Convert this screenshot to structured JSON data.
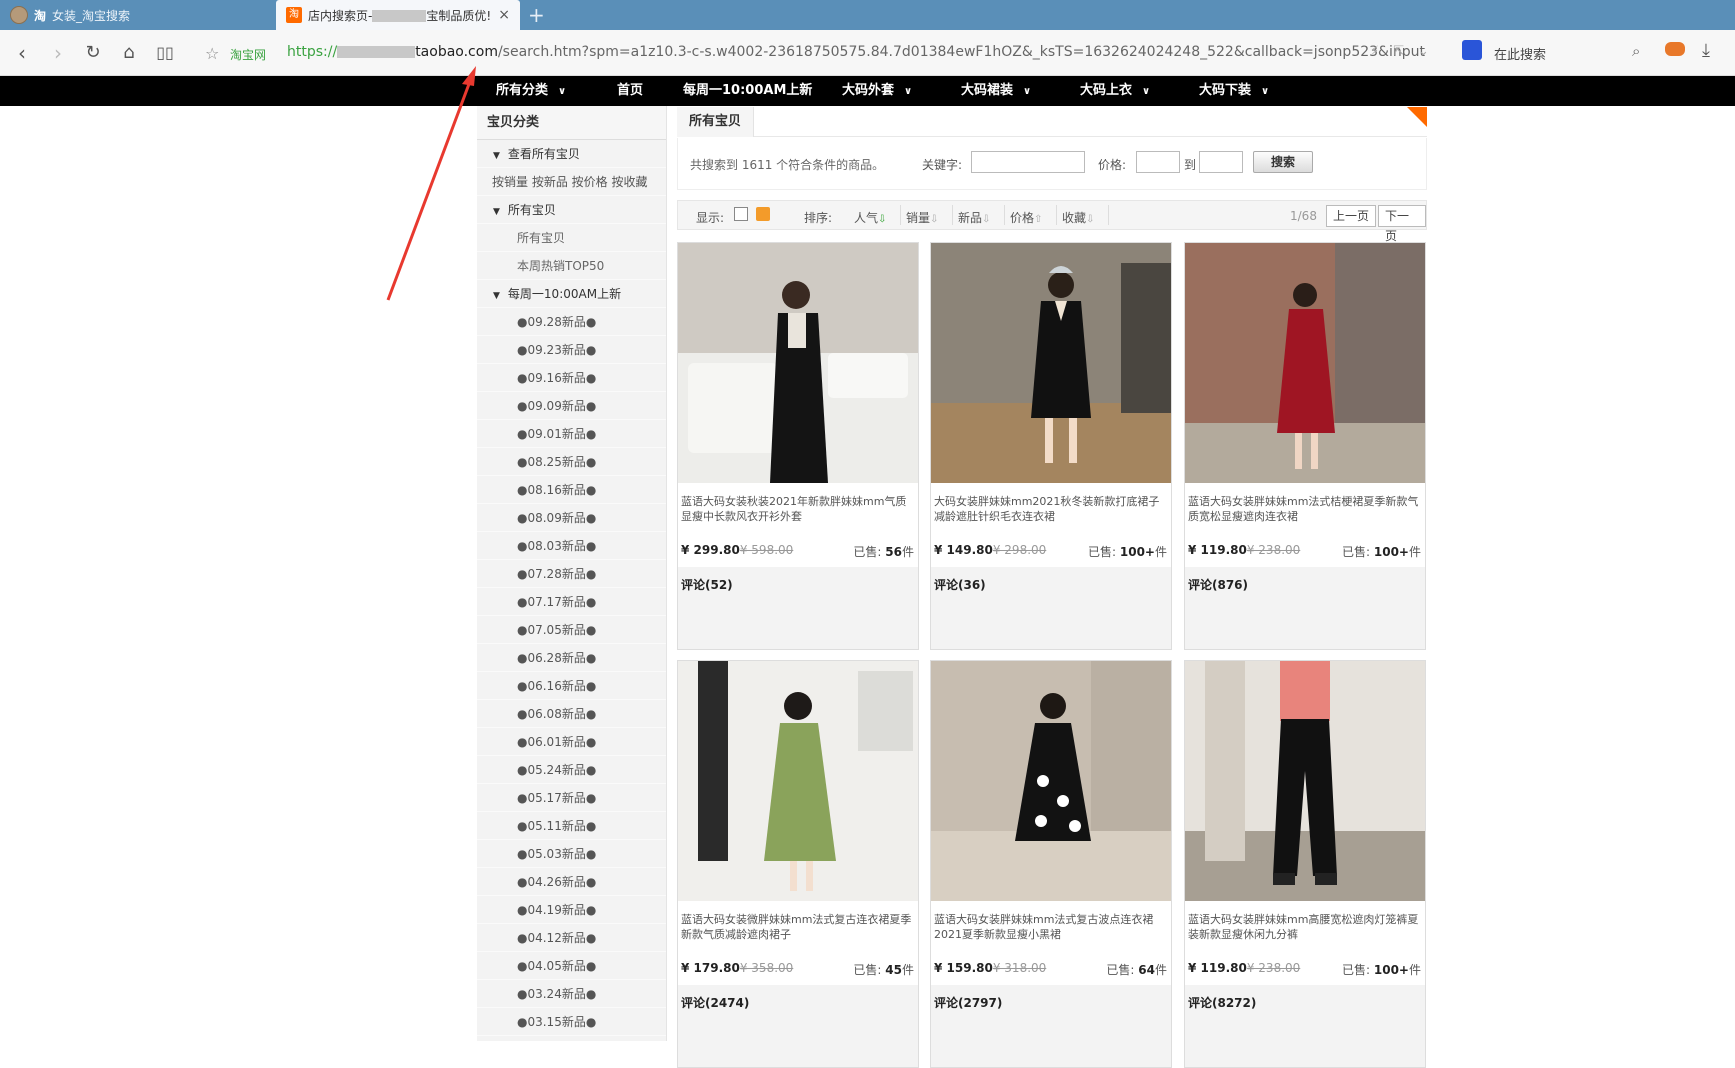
{
  "browser": {
    "tab1": {
      "mark": "淘",
      "title": "女装_淘宝搜索"
    },
    "tab2": {
      "mark": "淘",
      "title_prefix": "店内搜索页-",
      "title_suffix": "宝制品质优!"
    },
    "new_tab": "+",
    "close": "×",
    "site_label": "淘宝网",
    "url_proto": "https://",
    "url_host": "taobao.com",
    "url_path": "/search.htm?spm=a1z10.3-c-s.w4002-23618750575.84.7d01384ewF1hOZ&_ksTS=1632624024248_522&callback=jsonp523&input",
    "search_placeholder": "在此搜索"
  },
  "store_nav": [
    {
      "label": "所有分类",
      "chevron": true
    },
    {
      "label": "首页",
      "chevron": false
    },
    {
      "label": "每周一10:00AM上新",
      "chevron": false
    },
    {
      "label": "大码外套",
      "chevron": true
    },
    {
      "label": "大码裙装",
      "chevron": true
    },
    {
      "label": "大码上衣",
      "chevron": true
    },
    {
      "label": "大码下装",
      "chevron": true
    }
  ],
  "sidebar": {
    "heading": "宝贝分类",
    "view_all": "查看所有宝贝",
    "sort_links": "按销量 按新品 按价格 按收藏",
    "all_items_cat": "所有宝贝",
    "sub_items": [
      "所有宝贝",
      "本周热销TOP50"
    ],
    "weekly_cat": "每周一10:00AM上新",
    "new_dates": [
      "●09.28新品●",
      "●09.23新品●",
      "●09.16新品●",
      "●09.09新品●",
      "●09.01新品●",
      "●08.25新品●",
      "●08.16新品●",
      "●08.09新品●",
      "●08.03新品●",
      "●07.28新品●",
      "●07.17新品●",
      "●07.05新品●",
      "●06.28新品●",
      "●06.16新品●",
      "●06.08新品●",
      "●06.01新品●",
      "●05.24新品●",
      "●05.17新品●",
      "●05.11新品●",
      "●05.03新品●",
      "●04.26新品●",
      "●04.19新品●",
      "●04.12新品●",
      "●04.05新品●",
      "●03.24新品●",
      "●03.15新品●"
    ]
  },
  "main": {
    "crumb": "所有宝贝",
    "result_count": "共搜索到 1611 个符合条件的商品。",
    "keyword_label": "关键字:",
    "price_label": "价格:",
    "to_label": "到",
    "search_button": "搜索",
    "display_label": "显示:",
    "sort_label": "排序:",
    "sorts": [
      "人气",
      "销量",
      "新品",
      "价格",
      "收藏"
    ],
    "page_info": "1/68",
    "prev": "上一页",
    "next": "下一页"
  },
  "products": [
    {
      "title": "蓝语大码女装秋装2021年新款胖妹妹mm气质显瘦中长款风衣开衫外套",
      "price": "¥ 299.80",
      "old_price": "¥ 598.00",
      "sold_label": "已售:",
      "sold": "56",
      "unit": "件",
      "reviews": "评论(52)"
    },
    {
      "title": "大码女装胖妹妹mm2021秋冬装新款打底裙子减龄遮肚针织毛衣连衣裙",
      "price": "¥ 149.80",
      "old_price": "¥ 298.00",
      "sold_label": "已售:",
      "sold": "100+",
      "unit": "件",
      "reviews": "评论(36)"
    },
    {
      "title": "蓝语大码女装胖妹妹mm法式桔梗裙夏季新款气质宽松显瘦遮肉连衣裙",
      "price": "¥ 119.80",
      "old_price": "¥ 238.00",
      "sold_label": "已售:",
      "sold": "100+",
      "unit": "件",
      "reviews": "评论(876)"
    },
    {
      "title": "蓝语大码女装微胖妹妹mm法式复古连衣裙夏季新款气质减龄遮肉裙子",
      "price": "¥ 179.80",
      "old_price": "¥ 358.00",
      "sold_label": "已售:",
      "sold": "45",
      "unit": "件",
      "reviews": "评论(2474)"
    },
    {
      "title": "蓝语大码女装胖妹妹mm法式复古波点连衣裙2021夏季新款显瘦小黑裙",
      "price": "¥ 159.80",
      "old_price": "¥ 318.00",
      "sold_label": "已售:",
      "sold": "64",
      "unit": "件",
      "reviews": "评论(2797)"
    },
    {
      "title": "蓝语大码女装胖妹妹mm高腰宽松遮肉灯笼裤夏装新款显瘦休闲九分裤",
      "price": "¥ 119.80",
      "old_price": "¥ 238.00",
      "sold_label": "已售:",
      "sold": "100+",
      "unit": "件",
      "reviews": "评论(8272)"
    }
  ]
}
